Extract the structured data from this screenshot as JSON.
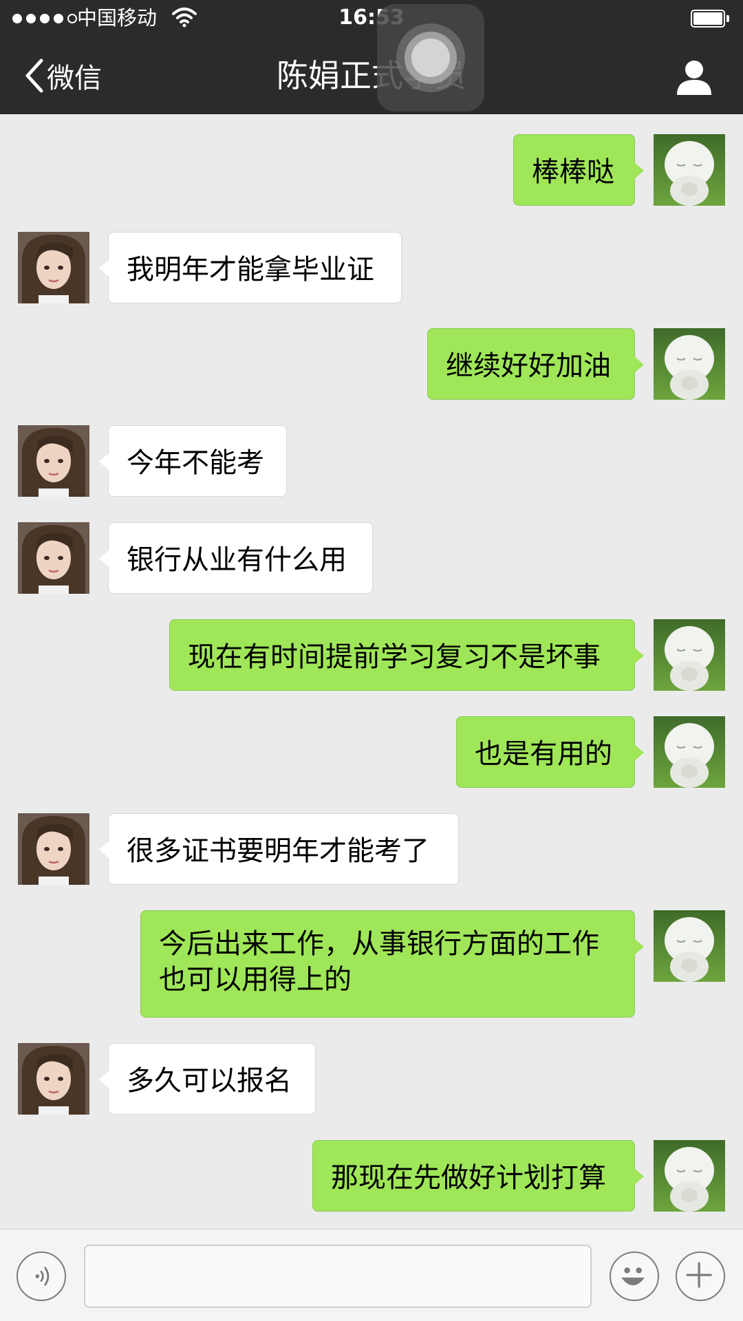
{
  "status_bar": {
    "carrier": "中国移动",
    "time": "16:53",
    "signal_bars_filled": 4,
    "signal_bars_total": 5
  },
  "nav": {
    "back_label": "微信",
    "title": "陈娟正式学员",
    "back_icon": "chevron-left-icon",
    "profile_icon": "person-icon"
  },
  "messages": [
    {
      "side": "out",
      "text": "棒棒哒"
    },
    {
      "side": "in",
      "text": "我明年才能拿毕业证"
    },
    {
      "side": "out",
      "text": "继续好好加油"
    },
    {
      "side": "in",
      "text": "今年不能考"
    },
    {
      "side": "in",
      "text": "银行从业有什么用"
    },
    {
      "side": "out",
      "text": "现在有时间提前学习复习不是坏事"
    },
    {
      "side": "out",
      "text": "也是有用的"
    },
    {
      "side": "in",
      "text": "很多证书要明年才能考了"
    },
    {
      "side": "out",
      "text": "今后出来工作，从事银行方面的工作也可以用得上的"
    },
    {
      "side": "in",
      "text": "多久可以报名"
    },
    {
      "side": "out",
      "text": "那现在先做好计划打算"
    }
  ],
  "input_bar": {
    "voice_icon": "voice-icon",
    "emoji_icon": "emoji-icon",
    "plus_icon": "plus-icon",
    "message_value": ""
  },
  "colors": {
    "nav_bg": "#2b2b2d",
    "chat_bg": "#ebebeb",
    "outgoing_bubble": "#9fe658",
    "incoming_bubble": "#ffffff"
  }
}
